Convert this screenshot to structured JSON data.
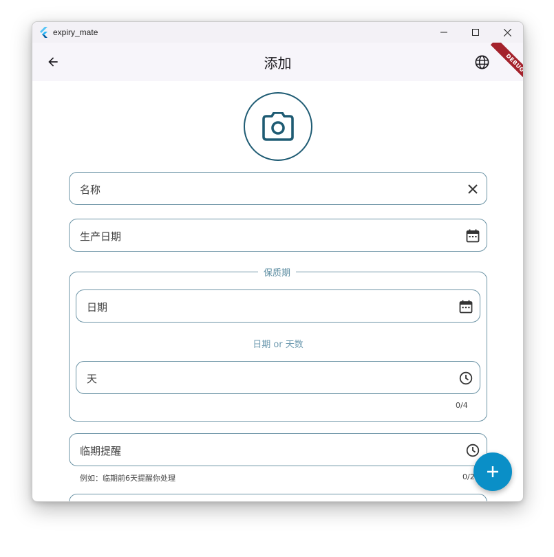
{
  "window": {
    "title": "expiry_mate",
    "controls": [
      "minimize",
      "maximize",
      "close"
    ]
  },
  "appbar": {
    "title": "添加",
    "back_icon": "arrow-back-icon",
    "language_icon": "globe-icon",
    "debug_label": "DEBUG"
  },
  "form": {
    "photo_icon": "camera-icon",
    "name": {
      "label": "名称",
      "icon": "clear-icon"
    },
    "production_date": {
      "label": "生产日期",
      "icon": "calendar-icon"
    },
    "shelf_life": {
      "legend": "保质期",
      "date": {
        "label": "日期",
        "icon": "calendar-icon"
      },
      "divider": "日期 or 天数",
      "days": {
        "label": "天",
        "icon": "clock-icon",
        "counter": "0/4"
      }
    },
    "reminder": {
      "label": "临期提醒",
      "icon": "clock-icon",
      "helper": "例如：临期前6天提醒你处理",
      "counter": "0/2"
    }
  },
  "fab": {
    "icon": "plus-icon"
  },
  "colors": {
    "accent": "#1e5b73",
    "border": "#6b93a5",
    "fab": "#0a8fc7",
    "debug": "#a4222c"
  }
}
